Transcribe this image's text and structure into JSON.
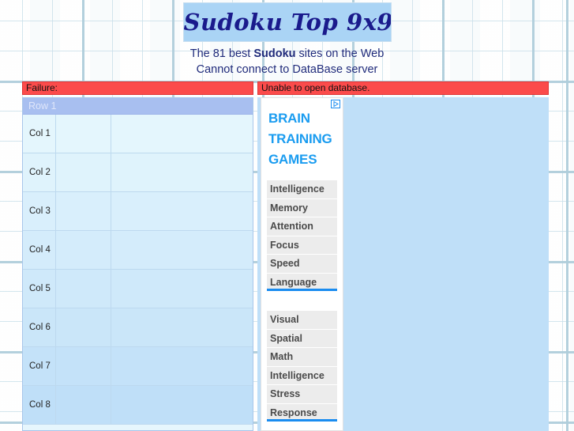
{
  "page": {
    "title": "Sudoku Top 9x9",
    "subtitle_prefix": "The 81 best ",
    "subtitle_brand": "Sudoku",
    "subtitle_suffix": " sites on the Web",
    "subtitle_line2": "Cannot connect to DataBase server"
  },
  "errors": {
    "left_label": "Failure:",
    "right_label": "Unable to open database."
  },
  "table": {
    "row_header": "Row 1",
    "rows": [
      {
        "label": "Col 1",
        "col2": "",
        "col3": ""
      },
      {
        "label": "Col 2",
        "col2": "",
        "col3": ""
      },
      {
        "label": "Col 3",
        "col2": "",
        "col3": ""
      },
      {
        "label": "Col 4",
        "col2": "",
        "col3": ""
      },
      {
        "label": "Col 5",
        "col2": "",
        "col3": ""
      },
      {
        "label": "Col 6",
        "col2": "",
        "col3": ""
      },
      {
        "label": "Col 7",
        "col2": "",
        "col3": ""
      },
      {
        "label": "Col 8",
        "col2": "",
        "col3": ""
      }
    ]
  },
  "ad": {
    "headline": [
      "BRAIN",
      "TRAINING",
      "GAMES"
    ],
    "group1": [
      "Intelligence",
      "Memory",
      "Attention",
      "Focus",
      "Speed",
      "Language"
    ],
    "group2": [
      "Visual",
      "Spatial",
      "Math",
      "Intelligence",
      "Stress",
      "Response"
    ],
    "choices_icon": "adchoices-play-icon"
  },
  "colors": {
    "error_red": "#fb4b4b",
    "panel_blue": "#bfdff8",
    "banner_blue": "#aad4f5",
    "title_navy": "#1a1a8c",
    "ad_blue": "#1a9cf0",
    "row_header_blue": "#a8bff0"
  }
}
